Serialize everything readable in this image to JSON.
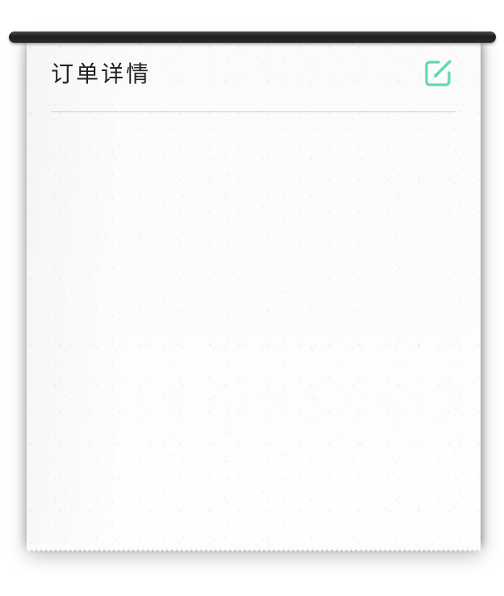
{
  "header": {
    "title": "订单详情",
    "edit_icon": "edit-icon"
  },
  "colors": {
    "accent": "#5fd8b3",
    "title_text": "#222222",
    "roller": "#2a2a2a",
    "paper": "#fcfcfc",
    "divider": "#cfcfcf"
  }
}
